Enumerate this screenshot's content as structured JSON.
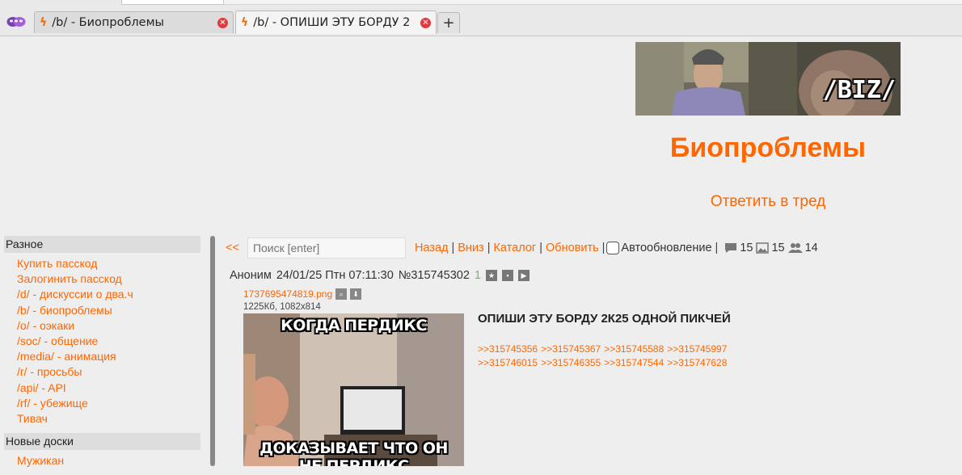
{
  "browser": {
    "tabs": [
      {
        "title": "/b/ - Биопроблемы",
        "active": false
      },
      {
        "title": "/b/ - ОПИШИ ЭТУ БОРДУ 2",
        "active": true
      }
    ],
    "new_tab_label": "+"
  },
  "banner": {
    "label": "/BIZ/"
  },
  "header": {
    "board_title": "Биопроблемы",
    "reply_link": "Ответить в тред"
  },
  "sidebar": {
    "sections": [
      {
        "title": "Разное",
        "items": [
          "Купить пасскод",
          "Залогинить пасскод",
          "/d/ - дискуссии о два.ч",
          "/b/ - биопроблемы",
          "/o/ - оэкаки",
          "/soc/ - общение",
          "/media/ - анимация",
          "/r/ - просьбы",
          "/api/ - API",
          "/rf/ - убежище",
          "Тивач"
        ]
      },
      {
        "title": "Новые доски",
        "items": [
          "Мужикан"
        ]
      }
    ]
  },
  "nav": {
    "back_arrows": "<<",
    "search_placeholder": "Поиск [enter]",
    "links": [
      "Назад",
      "Вниз",
      "Каталог",
      "Обновить"
    ],
    "autoupdate_label": "Автообновление",
    "autoupdate_checked": false,
    "posts_count": "15",
    "images_count": "15",
    "posters_count": "14"
  },
  "post": {
    "author": "Аноним",
    "date": "24/01/25 Птн 07:11:30",
    "number": "№315745302",
    "index": "1",
    "file_name": "1737695474819.png",
    "file_meta": "1225Кб, 1082x814",
    "meme_top": "КОГДА ПЕРДИКС",
    "meme_bottom": "ДОКАЗЫВАЕТ ЧТО ОН",
    "meme_bottom2": "НЕ ПЕРДИКС",
    "subject": "ОПИШИ ЭТУ БОРДУ 2К25 ОДНОЙ ПИКЧЕЙ",
    "replies": [
      [
        ">>315745356",
        ">>315745367",
        ">>315745588",
        ">>315745997"
      ],
      [
        ">>315746015",
        ">>315746355",
        ">>315747544",
        ">>315747628"
      ]
    ]
  },
  "colors": {
    "accent": "#ff6600",
    "background": "#eeeeee",
    "sidebar_head": "#dddddd"
  }
}
